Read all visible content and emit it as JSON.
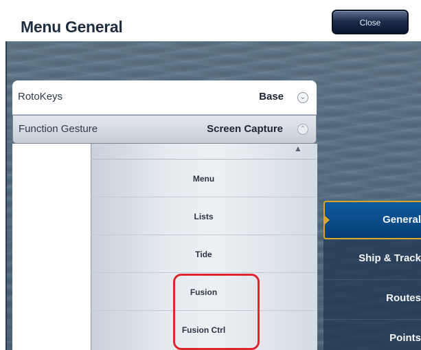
{
  "header": {
    "title": "Menu General",
    "close_label": "Close"
  },
  "settings": {
    "rotokeys": {
      "label": "RotoKeys",
      "value": "Base"
    },
    "function_gesture": {
      "label": "Function Gesture",
      "value": "Screen Capture"
    }
  },
  "dropdown": {
    "items": [
      "Menu",
      "Lists",
      "Tide",
      "Fusion",
      "Fusion Ctrl"
    ]
  },
  "nav": {
    "items": [
      "General",
      "Ship & Track",
      "Routes",
      "Points"
    ],
    "selected": "General"
  },
  "colors": {
    "highlight_box": "#e0232c",
    "selected_nav_border": "#d9a526",
    "selected_nav_bg": "#0a4a86"
  }
}
